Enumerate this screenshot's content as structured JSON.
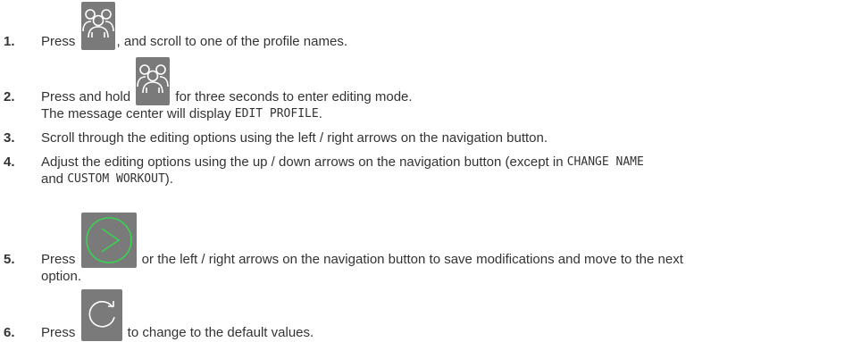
{
  "steps": [
    {
      "number": "1.",
      "before": "Press ",
      "icon": "profiles-icon",
      "after": ", and scroll to one of the profile names."
    },
    {
      "number": "2.",
      "before": "Press and hold ",
      "icon": "profiles-icon",
      "after": " for three seconds to enter editing mode.",
      "line2_before": "The message center will display ",
      "line2_code": "EDIT PROFILE",
      "line2_after": "."
    },
    {
      "number": "3.",
      "text": "Scroll through the editing options using the left / right arrows on the navigation button."
    },
    {
      "number": "4.",
      "line1_before": "Adjust the editing options using the up / down arrows on the navigation button (except in ",
      "line1_code": "CHANGE NAME",
      "line2_before": "and ",
      "line2_code": "CUSTOM WORKOUT",
      "line2_after": ")."
    },
    {
      "number": "5.",
      "before": "Press ",
      "icon": "start-icon",
      "after": " or the left / right arrows on the navigation button to save modifications and move to the next",
      "line2": "option."
    },
    {
      "number": "6.",
      "before": "Press ",
      "icon": "reset-icon",
      "after": " to change to the default values."
    }
  ],
  "colors": {
    "text": "#333333",
    "button_bg": "#7a7a7a",
    "icon_white": "#ffffff",
    "start_green": "#39d353"
  }
}
